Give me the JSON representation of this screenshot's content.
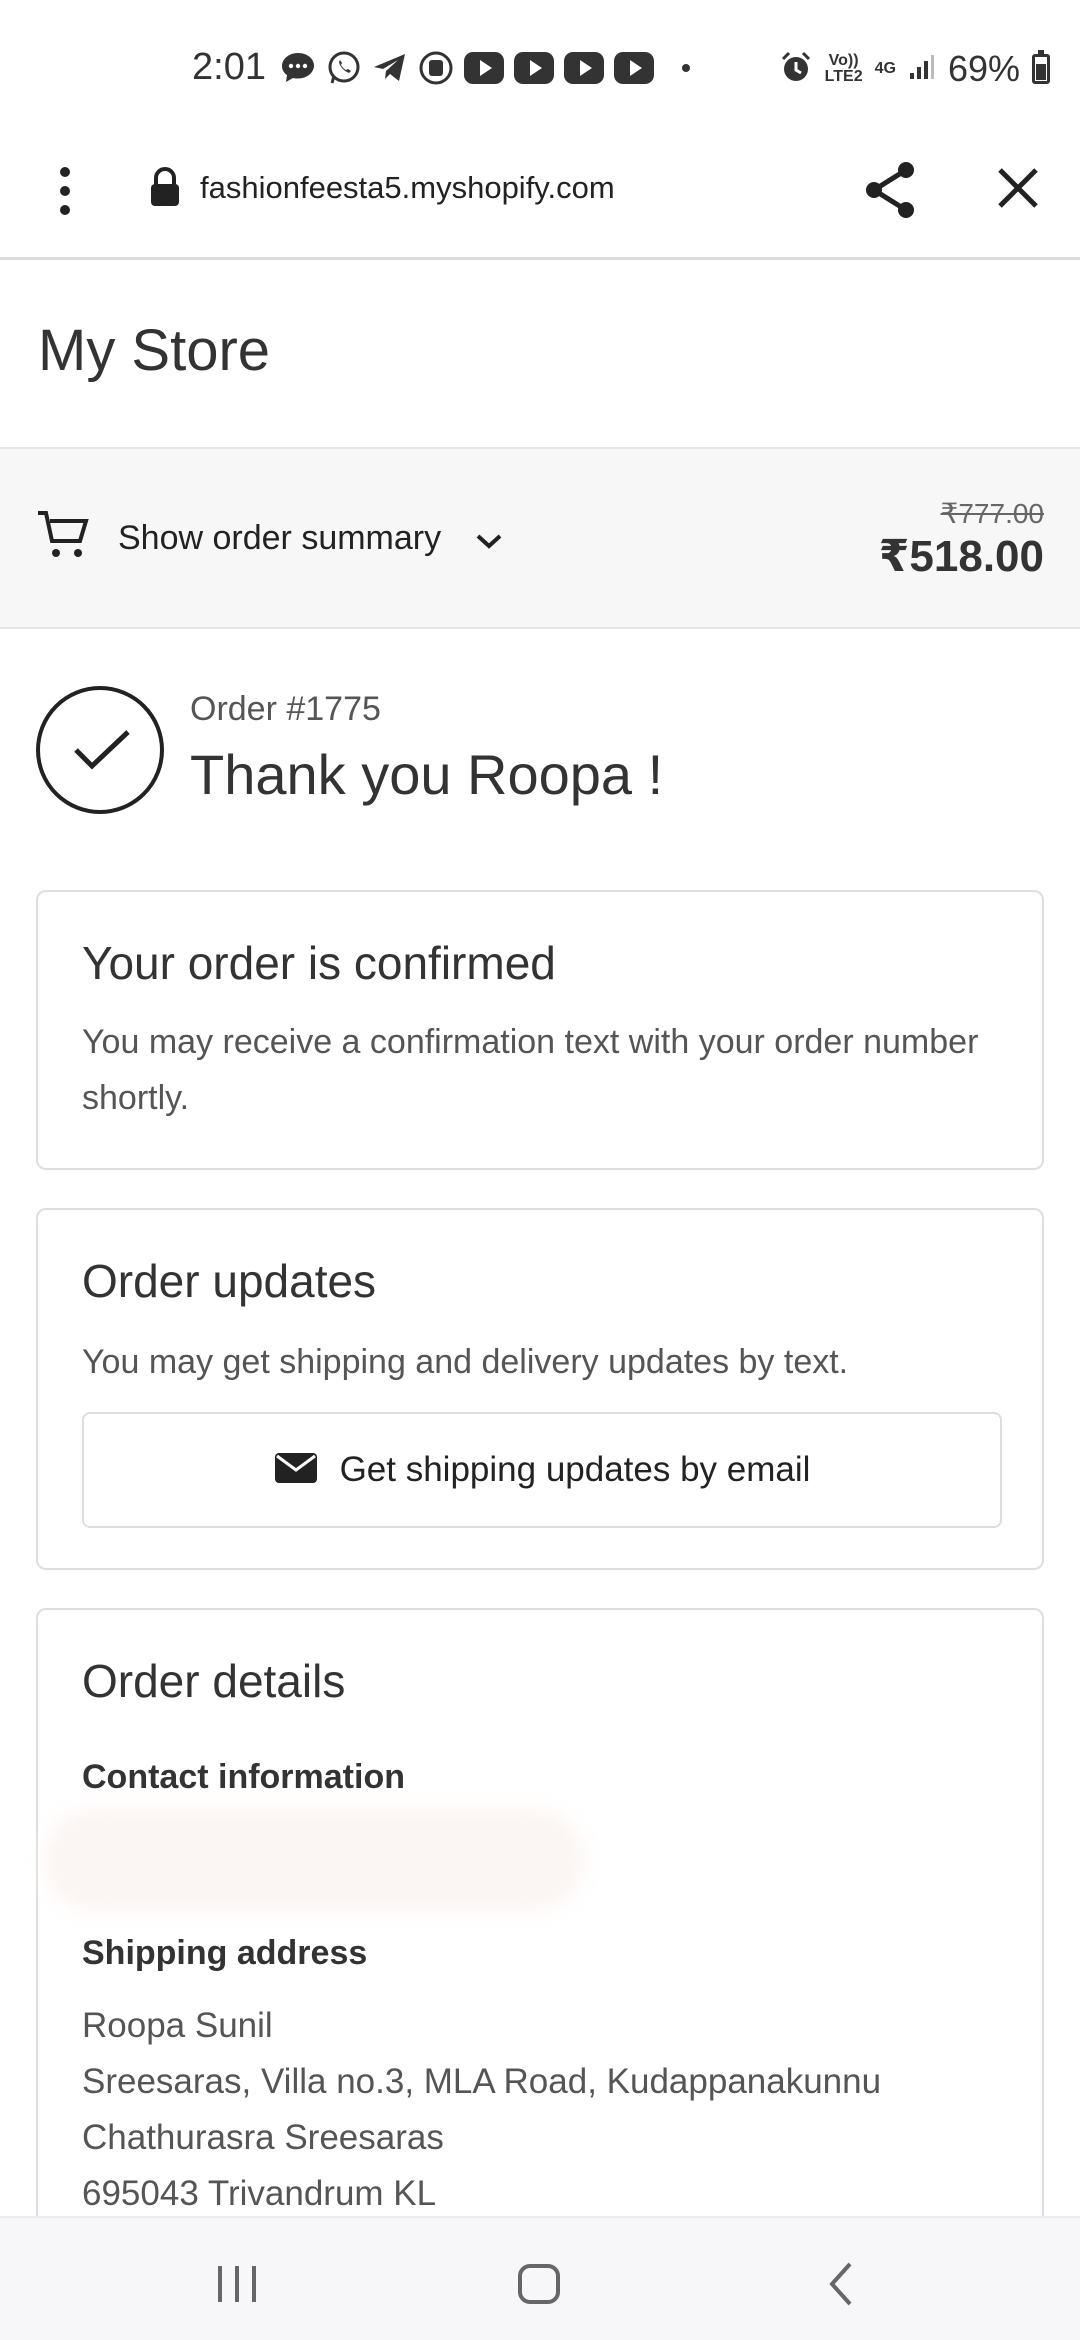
{
  "status_bar": {
    "time": "2:01",
    "notification_icons": [
      "message-icon",
      "whatsapp-icon",
      "telegram-icon",
      "threads-icon",
      "youtube-icon",
      "youtube-icon",
      "youtube-icon",
      "youtube-icon"
    ],
    "network_line1": "Vo))",
    "network_line2": "LTE2",
    "network_type": "4G",
    "battery": "69%"
  },
  "browser_bar": {
    "url": "fashionfeesta5.myshopify.com"
  },
  "store": {
    "title": "My Store"
  },
  "order_summary": {
    "label": "Show order summary",
    "original_price": "₹777.00",
    "total_price": "₹518.00"
  },
  "confirmation": {
    "order_number": "Order #1775",
    "thank_you": "Thank you Roopa !"
  },
  "order_confirmed_card": {
    "title": "Your order is confirmed",
    "text": "You may receive a confirmation text with your order number shortly."
  },
  "order_updates_card": {
    "title": "Order updates",
    "text": "You may get shipping and delivery updates by text.",
    "button_label": "Get shipping updates by email"
  },
  "order_details_card": {
    "title": "Order details",
    "contact_label": "Contact information",
    "shipping_label": "Shipping address",
    "address_lines": [
      "Roopa Sunil",
      "Sreesaras, Villa no.3, MLA Road, Kudappanakunnu",
      "Chathurasra Sreesaras",
      "695043 Trivandrum KL"
    ]
  },
  "colors": {
    "text_primary": "#333333",
    "text_secondary": "#555555",
    "border": "#dedede",
    "summary_background": "#f7f7f7"
  }
}
